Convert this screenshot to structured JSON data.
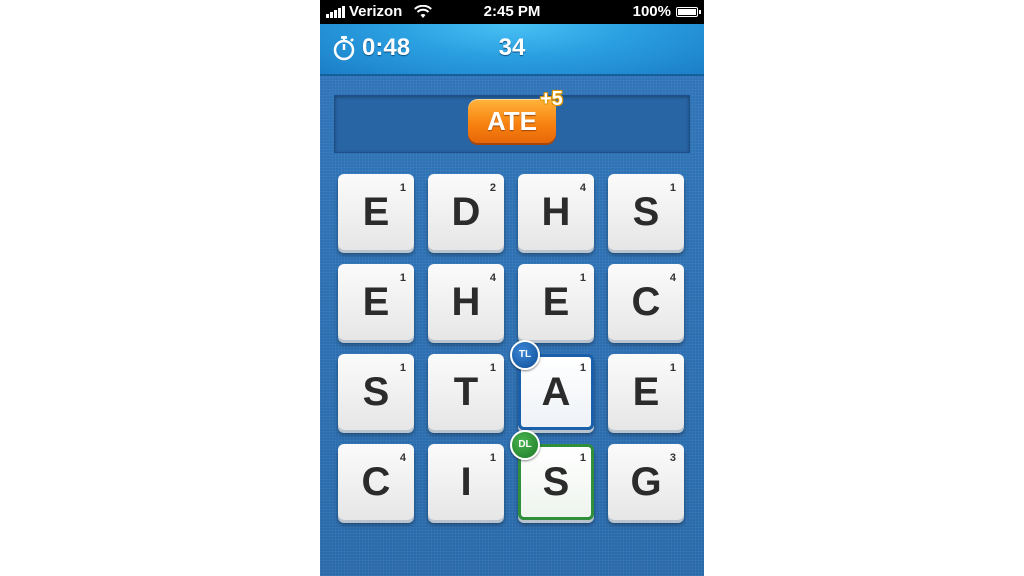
{
  "status_bar": {
    "carrier": "Verizon",
    "time": "2:45 PM",
    "battery": "100%"
  },
  "header": {
    "timer": "0:48",
    "score": "34"
  },
  "word_display": {
    "word": "ATE",
    "bonus": "+5"
  },
  "grid": [
    [
      {
        "letter": "E",
        "points": "1"
      },
      {
        "letter": "D",
        "points": "2"
      },
      {
        "letter": "H",
        "points": "4"
      },
      {
        "letter": "S",
        "points": "1"
      }
    ],
    [
      {
        "letter": "E",
        "points": "1"
      },
      {
        "letter": "H",
        "points": "4"
      },
      {
        "letter": "E",
        "points": "1"
      },
      {
        "letter": "C",
        "points": "4"
      }
    ],
    [
      {
        "letter": "S",
        "points": "1"
      },
      {
        "letter": "T",
        "points": "1"
      },
      {
        "letter": "A",
        "points": "1",
        "multiplier": "TL"
      },
      {
        "letter": "E",
        "points": "1"
      }
    ],
    [
      {
        "letter": "C",
        "points": "4"
      },
      {
        "letter": "I",
        "points": "1"
      },
      {
        "letter": "S",
        "points": "1",
        "multiplier": "DL"
      },
      {
        "letter": "G",
        "points": "3"
      }
    ]
  ],
  "colors": {
    "background": "#2e73b6",
    "header": "#2a9fe0",
    "word_pill": "#f77f0e",
    "triple_letter": "#0c4d95",
    "double_letter": "#1d7a26"
  }
}
